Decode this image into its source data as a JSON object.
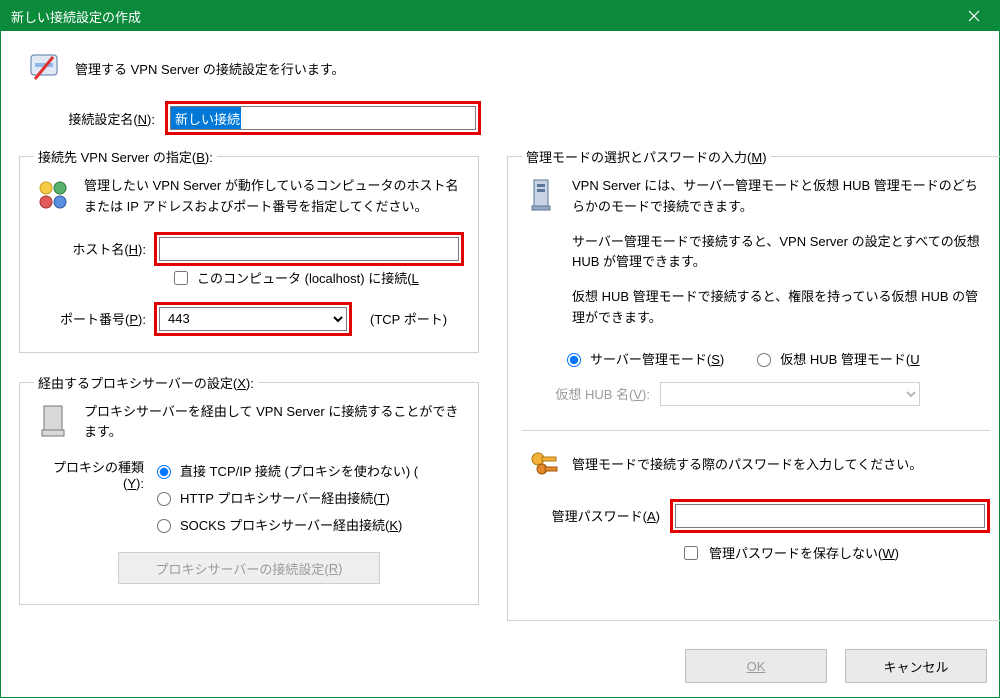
{
  "title": "新しい接続設定の作成",
  "intro": "管理する VPN Server の接続設定を行います。",
  "settingName": {
    "label": "接続設定名(",
    "accel": "N",
    "tail": "):",
    "value": "新しい接続"
  },
  "dest": {
    "legendPre": "接続先 VPN Server の指定(",
    "legendAccel": "B",
    "legendTail": "):",
    "desc": "管理したい VPN Server が動作しているコンピュータのホスト名または IP アドレスおよびポート番号を指定してください。",
    "host": {
      "labelPre": "ホスト名(",
      "accel": "H",
      "tail": "):",
      "value": ""
    },
    "localhost": {
      "pre": "このコンピュータ (localhost) に接続(",
      "accel": "L"
    },
    "port": {
      "labelPre": "ポート番号(",
      "accel": "P",
      "tail": "):",
      "value": "443",
      "tcp": "(TCP ポート)"
    }
  },
  "proxy": {
    "legendPre": "経由するプロキシサーバーの設定(",
    "legendAccel": "X",
    "legendTail": "):",
    "desc": "プロキシサーバーを経由して VPN Server に接続することができます。",
    "typeLabelPre": "プロキシの種類(",
    "typeAccel": "Y",
    "typeTail": "):",
    "opt1": "直接 TCP/IP 接続 (プロキシを使わない) (",
    "opt2pre": "HTTP プロキシサーバー経由接続(",
    "opt2accel": "T",
    "opt2tail": ")",
    "opt3pre": "SOCKS プロキシサーバー経由接続(",
    "opt3accel": "K",
    "opt3tail": ")",
    "btnPre": "プロキシサーバーの接続設定(",
    "btnAccel": "R",
    "btnTail": ")"
  },
  "mode": {
    "legendPre": "管理モードの選択とパスワードの入力(",
    "legendAccel": "M",
    "legendTail": ")",
    "p1": "VPN Server には、サーバー管理モードと仮想 HUB 管理モードのどちらかのモードで接続できます。",
    "p2": "サーバー管理モードで接続すると、VPN Server の設定とすべての仮想 HUB が管理できます。",
    "p3": "仮想 HUB 管理モードで接続すると、権限を持っている仮想 HUB の管理ができます。",
    "r1pre": "サーバー管理モード(",
    "r1accel": "S",
    "r1tail": ")",
    "r2pre": "仮想 HUB 管理モード(",
    "r2accel": "U",
    "r2tail": "",
    "hubLabelPre": "仮想 HUB 名(",
    "hubAccel": "V",
    "hubTail": "):",
    "pwIntro": "管理モードで接続する際のパスワードを入力してください。",
    "pwLabelPre": "管理パスワード(",
    "pwAccel": "A",
    "pwTail": ")",
    "saveChkPre": "管理パスワードを保存しない(",
    "saveAccel": "W",
    "saveTail": ")"
  },
  "footer": {
    "ok": "OK",
    "cancel": "キャンセル"
  }
}
